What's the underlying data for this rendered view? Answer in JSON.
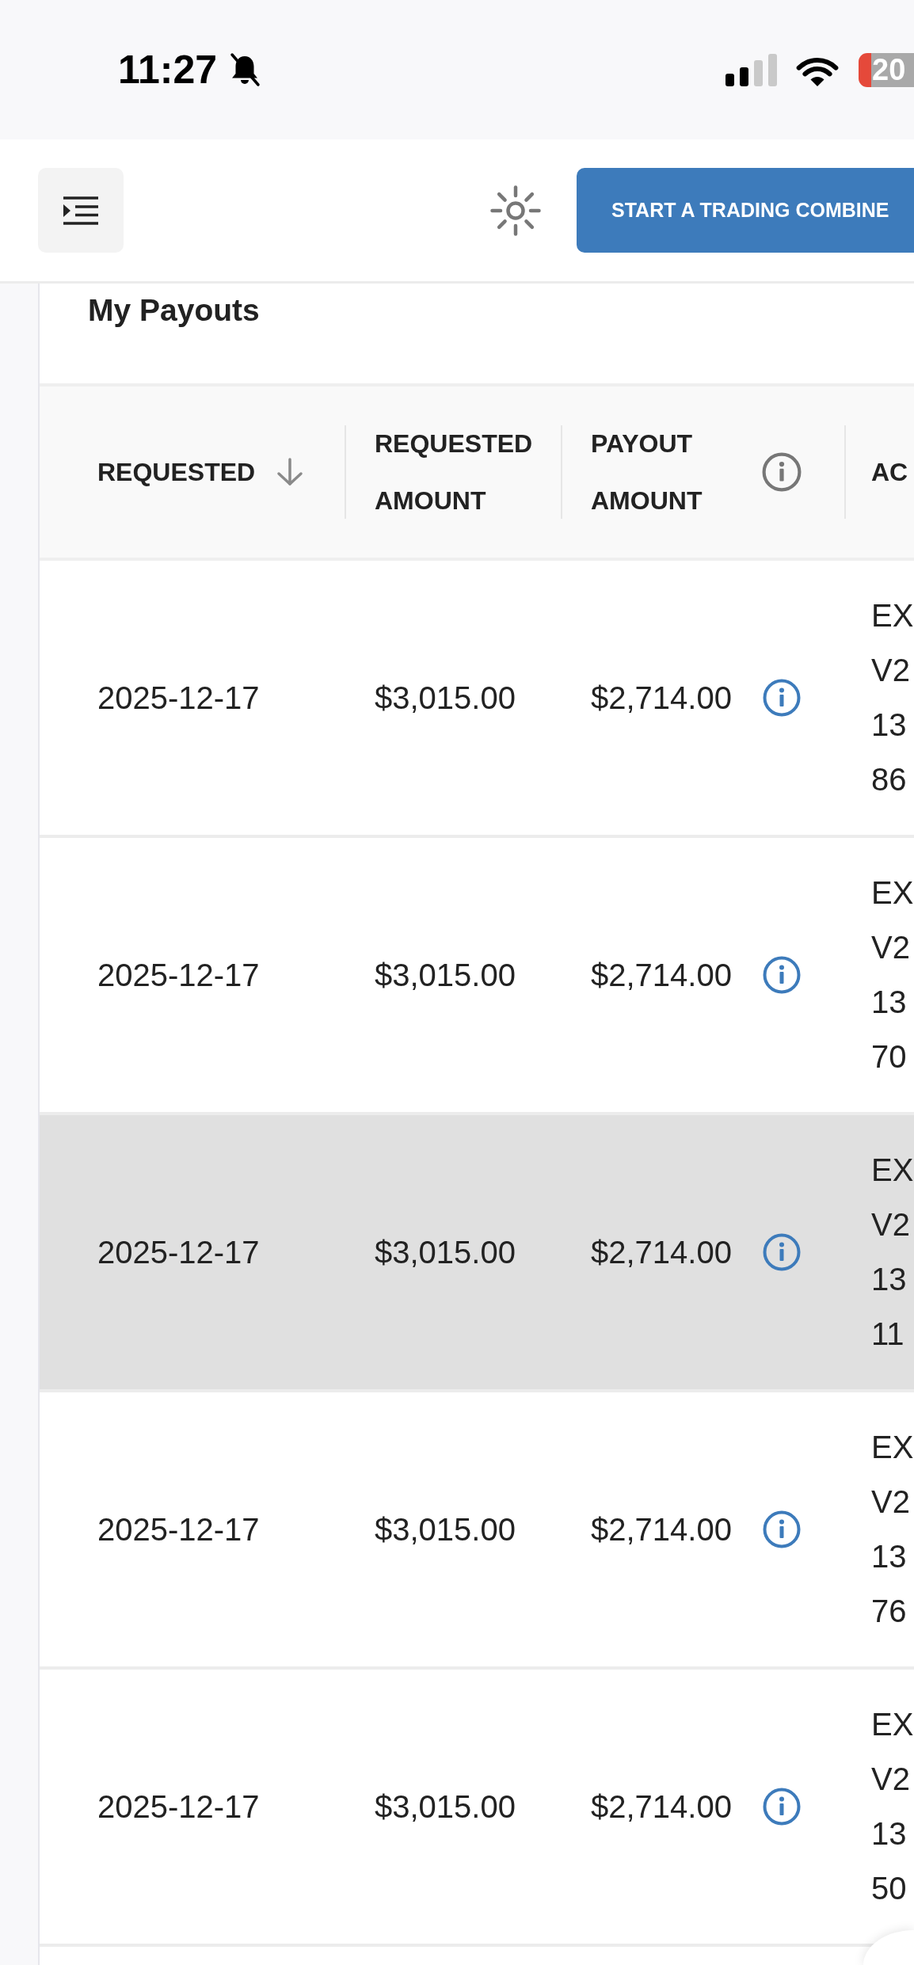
{
  "status_bar": {
    "time": "11:27",
    "silent": true,
    "battery": "20"
  },
  "header": {
    "button": "START A TRADING COMBINE"
  },
  "page": {
    "title": "My Payouts"
  },
  "table": {
    "columns": [
      {
        "label": "REQUESTED",
        "sorted": true,
        "info": false
      },
      {
        "label": "REQUESTED AMOUNT",
        "sorted": false,
        "info": false
      },
      {
        "label": "PAYOUT AMOUNT",
        "sorted": false,
        "info": true
      },
      {
        "label": "AC",
        "sorted": false,
        "info": false
      }
    ],
    "rows": [
      {
        "requested": "2025-12-17",
        "requested_amount": "$3,015.00",
        "payout_amount": "$2,714.00",
        "column_4": [
          "EX",
          "V2",
          "13",
          "86"
        ],
        "highlighted": false
      },
      {
        "requested": "2025-12-17",
        "requested_amount": "$3,015.00",
        "payout_amount": "$2,714.00",
        "column_4": [
          "EX",
          "V2",
          "13",
          "70"
        ],
        "highlighted": false
      },
      {
        "requested": "2025-12-17",
        "requested_amount": "$3,015.00",
        "payout_amount": "$2,714.00",
        "column_4": [
          "EX",
          "V2",
          "13",
          "11"
        ],
        "highlighted": true
      },
      {
        "requested": "2025-12-17",
        "requested_amount": "$3,015.00",
        "payout_amount": "$2,714.00",
        "column_4": [
          "EX",
          "V2",
          "13",
          "76"
        ],
        "highlighted": false
      },
      {
        "requested": "2025-12-17",
        "requested_amount": "$3,015.00",
        "payout_amount": "$2,714.00",
        "column_4": [
          "EX",
          "V2",
          "13",
          "50"
        ],
        "highlighted": false
      }
    ]
  }
}
